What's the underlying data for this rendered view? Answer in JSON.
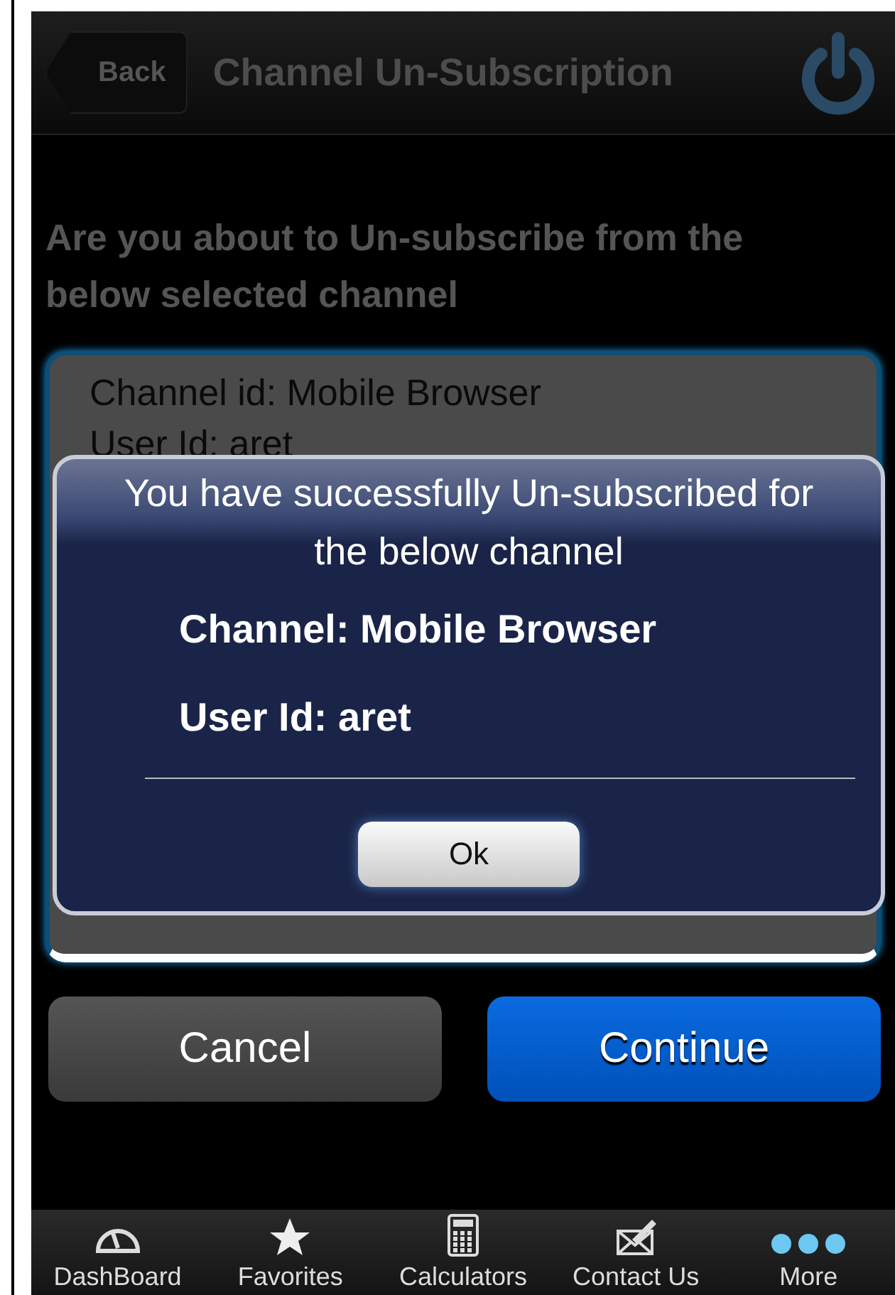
{
  "header": {
    "back": "Back",
    "title": "Channel Un-Subscription"
  },
  "question": "Are you about to Un-subscribe from the below selected channel",
  "details": [
    "Channel id: Mobile Browser",
    "User Id: aret"
  ],
  "dialog": {
    "message": "You have successfully Un-subscribed for the below channel",
    "lines": [
      "Channel: Mobile Browser",
      "User Id: aret"
    ],
    "button": "Ok"
  },
  "actions": [
    {
      "label": "Cancel",
      "kind": "secondary"
    },
    {
      "label": "Continue",
      "kind": "primary"
    }
  ],
  "tabs": [
    {
      "label": "DashBoard",
      "kind": "gauge"
    },
    {
      "label": "Favorites",
      "kind": "star"
    },
    {
      "label": "Calculators",
      "kind": "calculator"
    },
    {
      "label": "Contact Us",
      "kind": "mail"
    },
    {
      "label": "More",
      "kind": "more"
    }
  ]
}
